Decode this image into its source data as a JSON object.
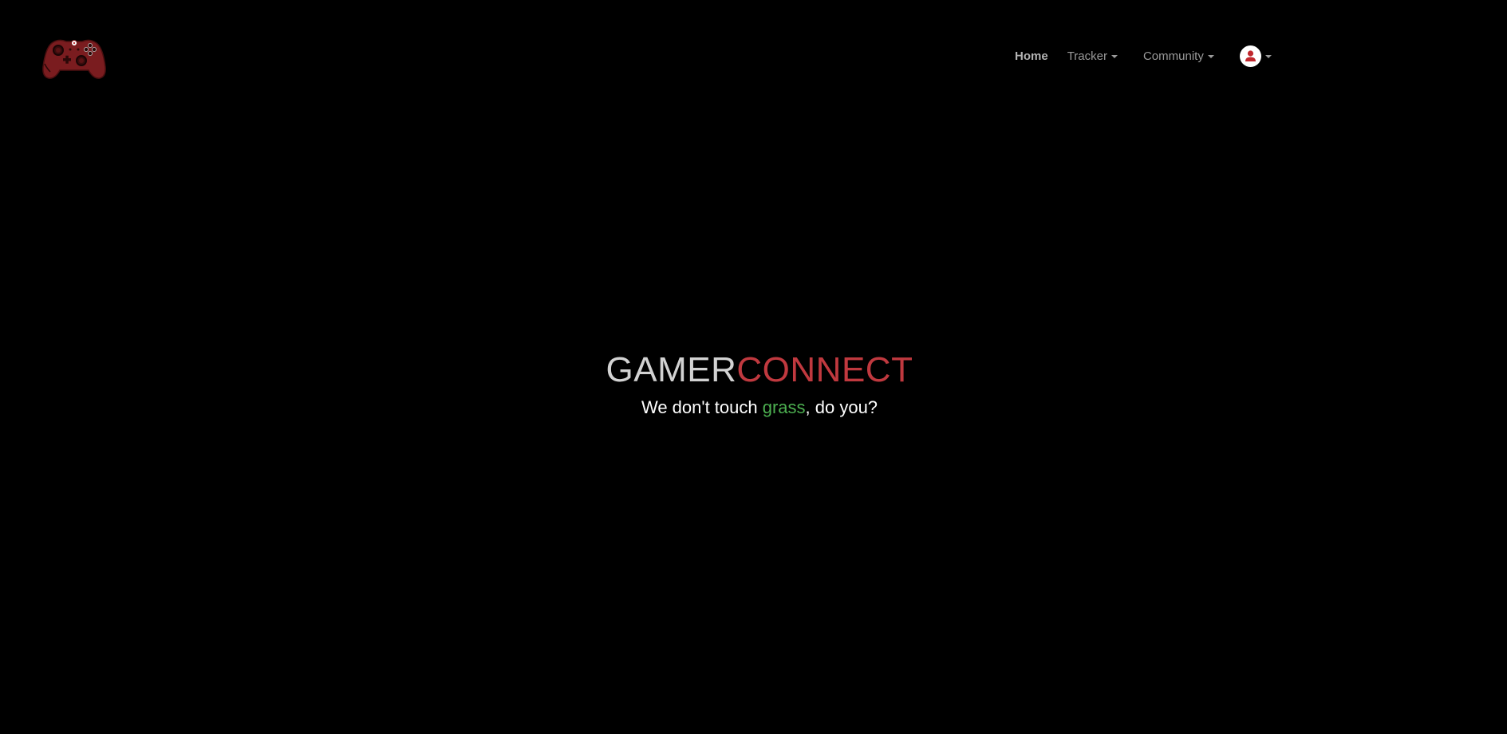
{
  "app": {
    "logo_icon": "gamepad-controller-icon",
    "colors": {
      "background": "#000000",
      "brand_primary": "#d2d2d2",
      "brand_accent": "#c0393f",
      "tagline_accent": "#4caf50",
      "nav_text": "#9a9a9a"
    }
  },
  "nav": {
    "home": "Home",
    "tracker": "Tracker",
    "community": "Community",
    "user_icon": "user-avatar-icon"
  },
  "hero": {
    "brand_part1": "GAMER",
    "brand_part2": "CONNECT",
    "tagline_before": "We don't touch ",
    "tagline_accent": "grass",
    "tagline_after": ", do you?"
  }
}
